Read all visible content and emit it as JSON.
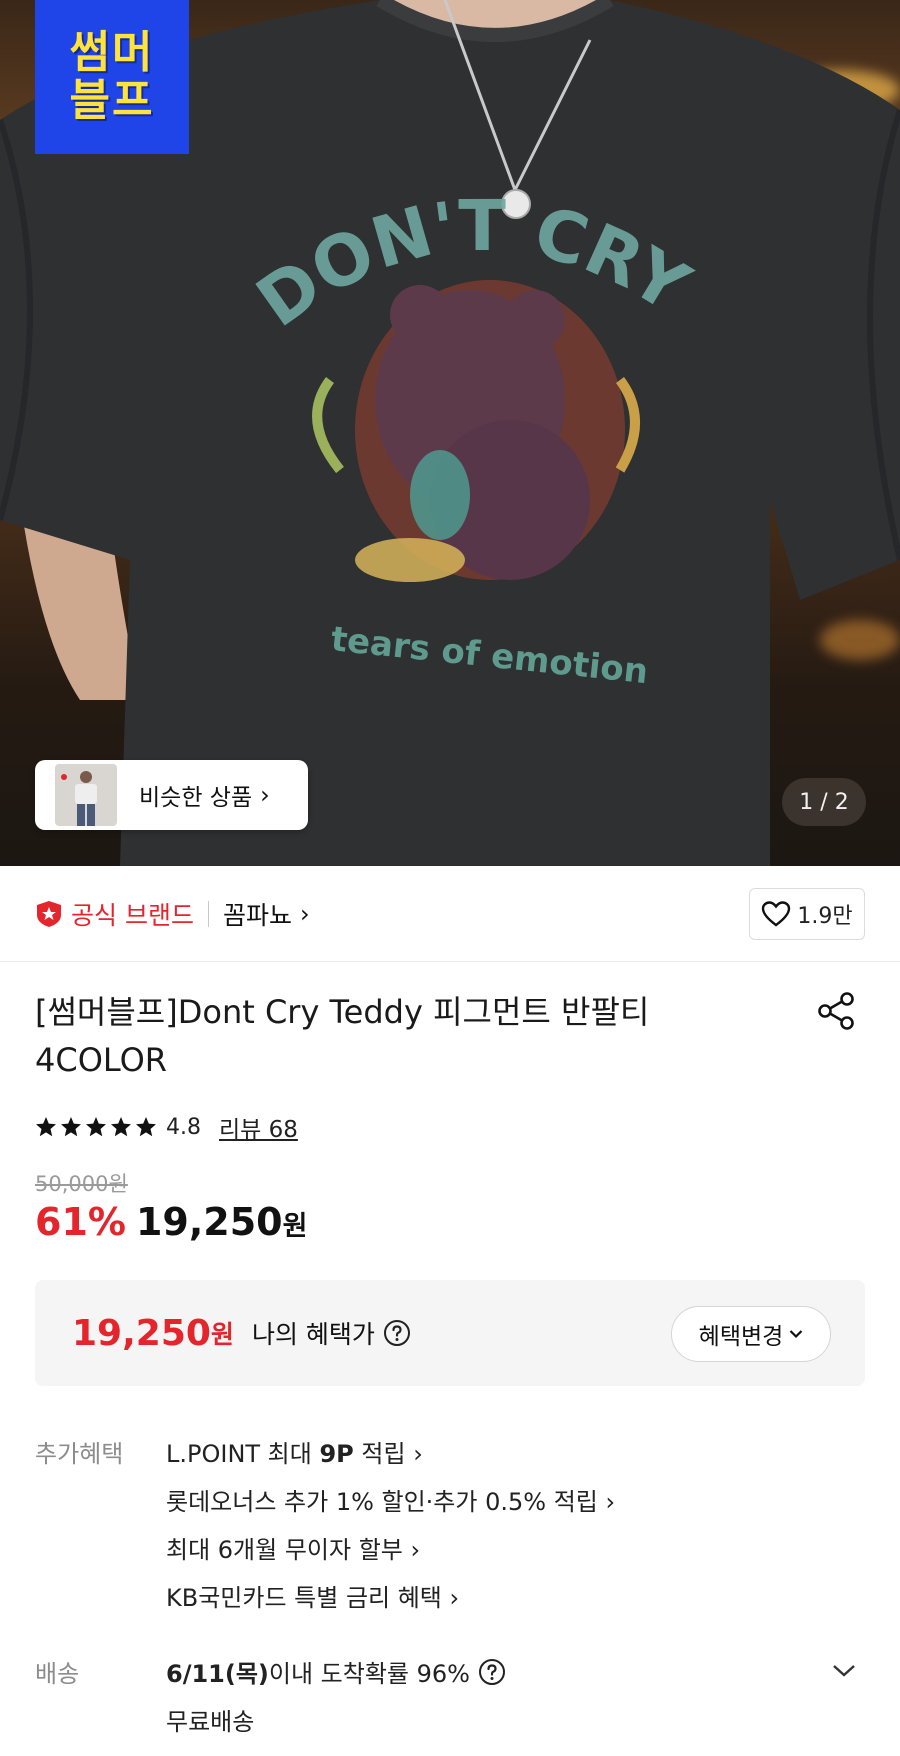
{
  "hero": {
    "badge_lines": [
      "썸머",
      "블프"
    ],
    "similar_label": "비슷한 상품",
    "pager": "1 / 2"
  },
  "brand": {
    "official_label": "공식 브랜드",
    "name": "꼼파뇨",
    "likes": "1.9만"
  },
  "product": {
    "title": "[썸머블프]Dont Cry Teddy 피그먼트 반팔티 4COLOR",
    "rating": "4.8",
    "rating_stars": 5,
    "review_label": "리뷰 68",
    "original_price": "50,000원",
    "discount": "61%",
    "price": "19,250",
    "price_unit": "원"
  },
  "benefit": {
    "my_price": "19,250",
    "my_price_unit": "원",
    "label": "나의 혜택가",
    "change_button": "혜택변경"
  },
  "extra": {
    "label": "추가혜택",
    "items": [
      {
        "prefix": "L.POINT 최대 ",
        "bold": "9P",
        "suffix": " 적립 ›"
      },
      {
        "text": "롯데오너스 추가 1% 할인·추가 0.5% 적립 ›"
      },
      {
        "text": "최대 6개월 무이자 할부 ›"
      },
      {
        "text": "KB국민카드 특별 금리 혜택 ›"
      }
    ]
  },
  "delivery": {
    "label": "배송",
    "date": "6/11(목)",
    "text": " 이내 도착확률 96%",
    "fee": "무료배송"
  },
  "colors": {
    "accent_red": "#e5252c",
    "badge_blue": "#1f45e8",
    "badge_yellow": "#ffe23a"
  }
}
